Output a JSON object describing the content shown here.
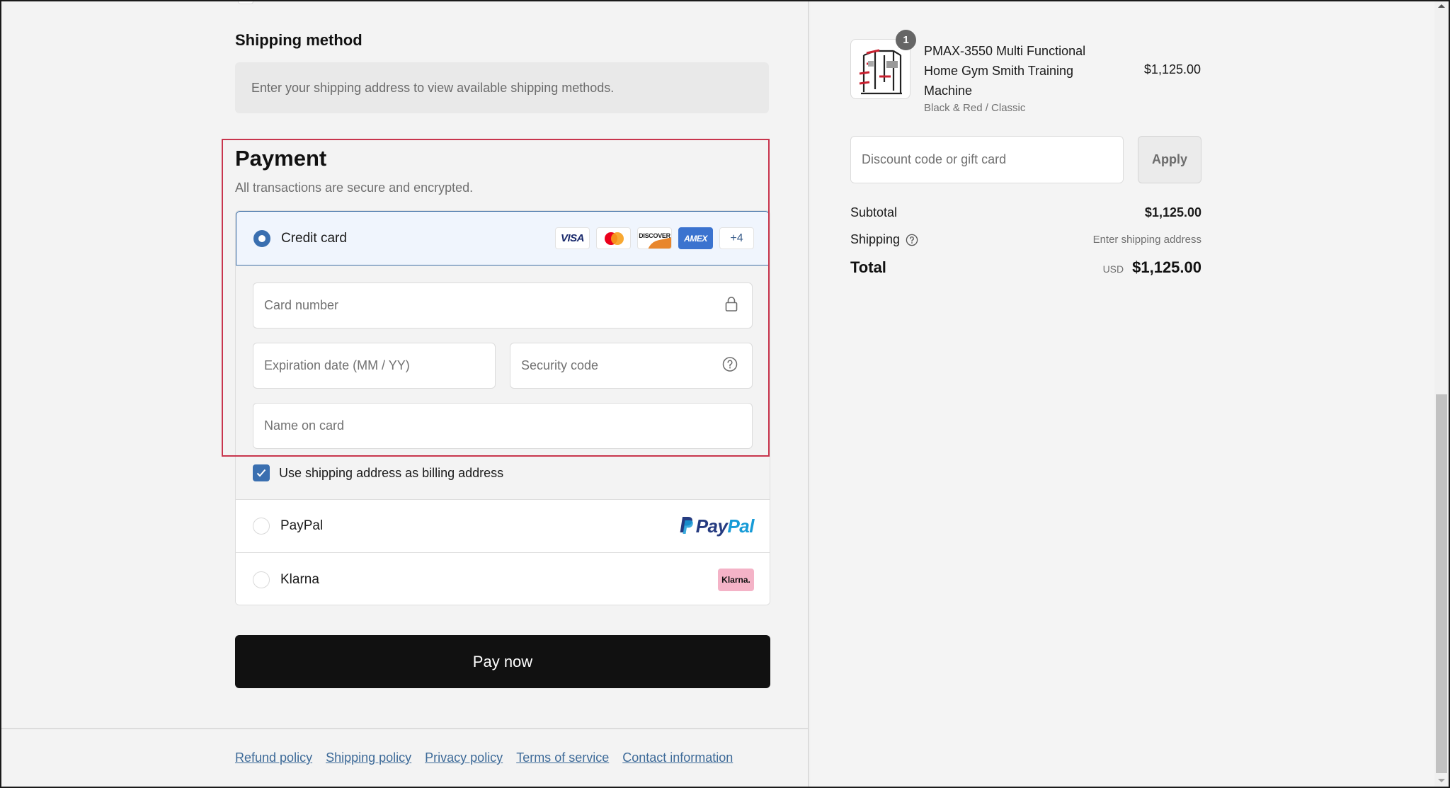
{
  "shipping_method": {
    "title": "Shipping method",
    "message": "Enter your shipping address to view available shipping methods."
  },
  "payment": {
    "title": "Payment",
    "subtitle": "All transactions are secure and encrypted.",
    "methods": [
      {
        "label": "Credit card",
        "selected": true
      },
      {
        "label": "PayPal",
        "selected": false
      },
      {
        "label": "Klarna",
        "selected": false
      }
    ],
    "card_logos": {
      "visa": "VISA",
      "discover": "DISCOVER",
      "amex": "AMEX",
      "more": "+4"
    },
    "fields": {
      "card_number": {
        "placeholder": "Card number",
        "value": ""
      },
      "expiration": {
        "placeholder": "Expiration date (MM / YY)",
        "value": ""
      },
      "security_code": {
        "placeholder": "Security code",
        "value": ""
      },
      "name_on_card": {
        "placeholder": "Name on card",
        "value": ""
      }
    },
    "billing_checkbox": {
      "label": "Use shipping address as billing address",
      "checked": true
    },
    "paypal_logo": {
      "pay": "Pay",
      "pal": "Pal"
    },
    "klarna_logo": "Klarna."
  },
  "pay_button": "Pay now",
  "footer_links": [
    "Refund policy",
    "Shipping policy",
    "Privacy policy",
    "Terms of service",
    "Contact information"
  ],
  "order_summary": {
    "item": {
      "quantity": "1",
      "title": "PMAX-3550 Multi Functional Home Gym Smith Training Machine",
      "variant": "Black & Red / Classic",
      "price": "$1,125.00"
    },
    "discount": {
      "placeholder": "Discount code or gift card",
      "value": "",
      "apply_label": "Apply"
    },
    "subtotal": {
      "label": "Subtotal",
      "value": "$1,125.00"
    },
    "shipping": {
      "label": "Shipping",
      "value": "Enter shipping address"
    },
    "total": {
      "label": "Total",
      "currency": "USD",
      "value": "$1,125.00"
    }
  },
  "colors": {
    "accent": "#3a6fb0",
    "pay_button": "#111111",
    "link": "#3d6a98",
    "annotation": "#c8354d"
  }
}
